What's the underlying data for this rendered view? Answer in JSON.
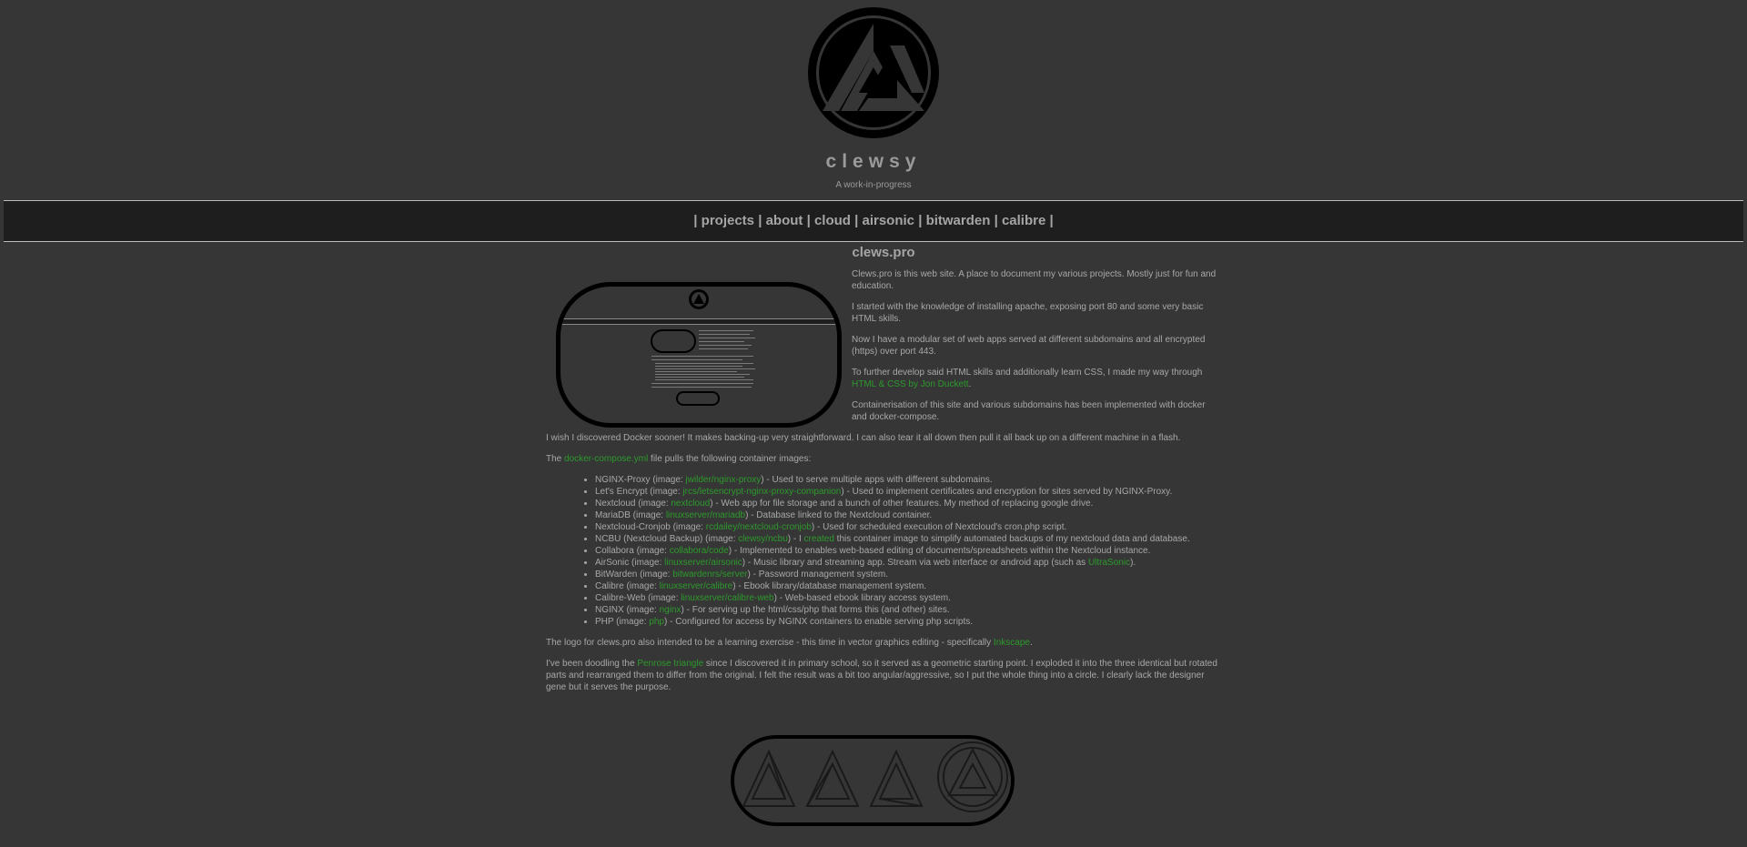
{
  "site": {
    "title": "clewsy",
    "tagline": "A work-in-progress"
  },
  "nav": {
    "items": [
      "projects",
      "about",
      "cloud",
      "airsonic",
      "bitwarden",
      "calibre"
    ],
    "separator": "|"
  },
  "main": {
    "title": "clews.pro",
    "intro_paragraphs": [
      "Clews.pro is this web site. A place to document my various projects. Mostly just for fun and education.",
      "I started with the knowledge of installing apache, exposing port 80 and some very basic HTML skills.",
      "Now I have a modular set of web apps served at different subdomains and all encrypted (https) over port 443."
    ],
    "css_para": {
      "before": "To further develop said HTML skills and additionally learn CSS, I made my way through ",
      "link": "HTML & CSS by Jon Duckett",
      "after": "."
    },
    "container_para": "Containerisation of this site and various subdomains has been implemented with docker and docker-compose.",
    "docker_para": "I wish I discovered Docker sooner! It makes backing-up very straightforward. I can also tear it all down then pull it all back up on a different machine in a flash.",
    "compose_para": {
      "before": "The ",
      "link": "docker-compose.yml",
      "after": " file pulls the following container images:"
    },
    "containers": [
      {
        "name": "NGINX-Proxy",
        "image": "jwilder/nginx-proxy",
        "desc": " - Used to serve multiple apps with different subdomains."
      },
      {
        "name": "Let's Encrypt",
        "image": "jrcs/letsencrypt-nginx-proxy-companion",
        "desc": " - Used to implement certificates and encryption for sites served by NGINX-Proxy."
      },
      {
        "name": "Nextcloud",
        "image": "nextcloud",
        "desc": " - Web app for file storage and a bunch of other features. My method of replacing google drive."
      },
      {
        "name": "MariaDB",
        "image": "linuxserver/mariadb",
        "desc": " - Database linked to the Nextcloud container."
      },
      {
        "name": "Nextcloud-Cronjob",
        "image": "rcdailey/nextcloud-cronjob",
        "desc": " - Used for scheduled execution of Nextcloud's cron.php script."
      },
      {
        "name": "NCBU (Nextcloud Backup)",
        "image": "clewsy/ncbu",
        "desc": " - I created this container image to simplify automated backups of my nextcloud data and database.",
        "desc_link": "created"
      },
      {
        "name": "Collabora",
        "image": "collabora/code",
        "desc": " - Implemented to enables web-based editing of documents/spreadsheets within the Nextcloud instance."
      },
      {
        "name": "AirSonic",
        "image": "linuxserver/airsonic",
        "desc": " - Music library and streaming app. Stream via web interface or android app (such as UltraSonic).",
        "desc_link": "UltraSonic"
      },
      {
        "name": "BitWarden",
        "image": "bitwardenrs/server",
        "desc": " - Password management system."
      },
      {
        "name": "Calibre",
        "image": "linuxserver/calibre",
        "desc": " - Ebook library/database management system."
      },
      {
        "name": "Calibre-Web",
        "image": "linuxserver/calibre-web",
        "desc": " - Web-based ebook library access system."
      },
      {
        "name": "NGINX",
        "image": "nginx",
        "desc": " - For serving up the html/css/php that forms this (and other) sites."
      },
      {
        "name": "PHP",
        "image": "php",
        "desc": " - Configured for access by NGINX containers to enable serving php scripts."
      }
    ],
    "logo_para": {
      "before": "The logo for clews.pro also intended to be a learning exercise - this time in vector graphics editing - specifically ",
      "link": "Inkscape",
      "after": "."
    },
    "penrose_para": {
      "before": "I've been doodling the ",
      "link": "Penrose triangle",
      "after": " since I discovered it in primary school, so it served as a geometric starting point. I exploded it into the three identical but rotated parts and rearranged them to differ from the original. I felt the result was a bit too angular/aggressive, so I put the whole thing into a circle. I clearly lack the designer gene but it serves the purpose."
    }
  },
  "colors": {
    "background": "#363636",
    "text": "#a8a8a8",
    "link": "#2c9a2c",
    "navbar": "#1e1e1e"
  },
  "icons": {
    "logo": "penrose-triangle-circle-logo"
  }
}
